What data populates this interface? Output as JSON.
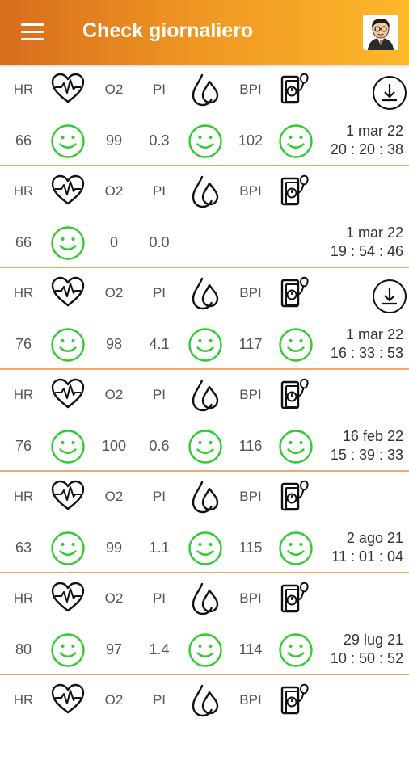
{
  "app_title": "Check giornaliero",
  "icons": {
    "menu": "hamburger-menu-icon",
    "profile": "doctor-avatar-icon",
    "heart": "heart-rate-icon",
    "drop": "perfusion-drop-icon",
    "bp": "blood-pressure-monitor-icon",
    "smiley": "smiley-face-icon",
    "download": "download-icon"
  },
  "colors": {
    "accent_start": "#d86c1c",
    "accent_end": "#fdb92a",
    "smiley": "#2ecc2e",
    "divider": "#f4a66b"
  },
  "labels": {
    "hr": "HR",
    "o2": "O2",
    "pi": "PI",
    "bpi": "BPI"
  },
  "records": [
    {
      "hr": "66",
      "o2": "99",
      "pi": "0.3",
      "bpi": "102",
      "date": "1 mar 22",
      "time": "20 : 20 : 38",
      "download": true,
      "pi_ok": true,
      "bpi_ok": true
    },
    {
      "hr": "66",
      "o2": "0",
      "pi": "0.0",
      "bpi": "",
      "date": "1 mar 22",
      "time": "19 : 54 : 46",
      "download": false,
      "pi_ok": false,
      "bpi_ok": false
    },
    {
      "hr": "76",
      "o2": "98",
      "pi": "4.1",
      "bpi": "117",
      "date": "1 mar 22",
      "time": "16 : 33 : 53",
      "download": true,
      "pi_ok": true,
      "bpi_ok": true
    },
    {
      "hr": "76",
      "o2": "100",
      "pi": "0.6",
      "bpi": "116",
      "date": "16 feb 22",
      "time": "15 : 39 : 33",
      "download": false,
      "pi_ok": true,
      "bpi_ok": true
    },
    {
      "hr": "63",
      "o2": "99",
      "pi": "1.1",
      "bpi": "115",
      "date": "2 ago 21",
      "time": "11 : 01 : 04",
      "download": false,
      "pi_ok": true,
      "bpi_ok": true
    },
    {
      "hr": "80",
      "o2": "97",
      "pi": "1.4",
      "bpi": "114",
      "date": "29 lug 21",
      "time": "10 : 50 : 52",
      "download": false,
      "pi_ok": true,
      "bpi_ok": true
    },
    {
      "hr": "",
      "o2": "",
      "pi": "",
      "bpi": "",
      "date": "",
      "time": "",
      "download": false,
      "pi_ok": false,
      "bpi_ok": false,
      "partial": true
    }
  ]
}
